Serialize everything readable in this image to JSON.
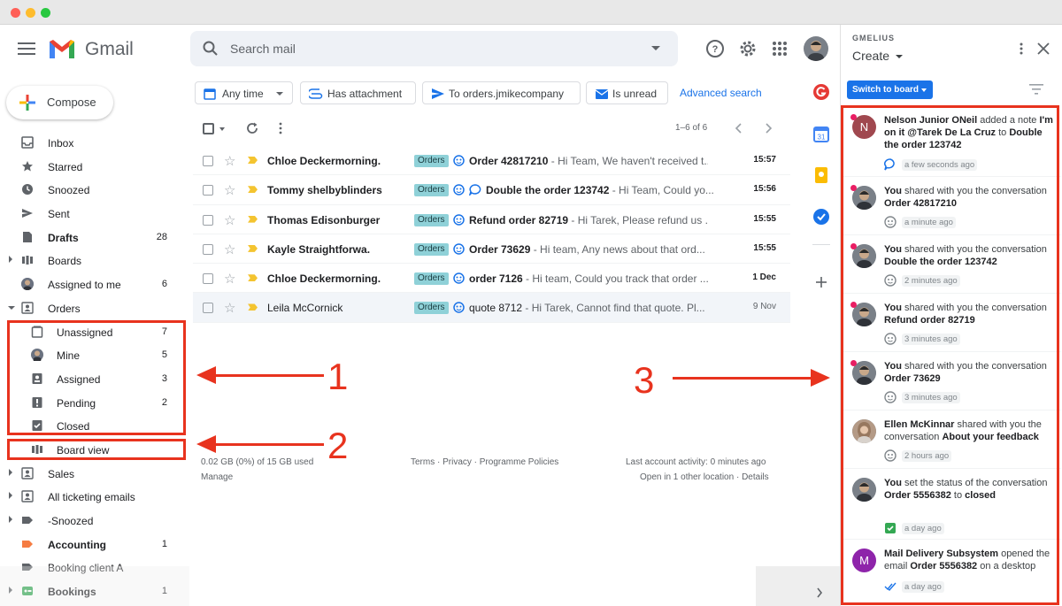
{
  "app": {
    "name": "Gmail"
  },
  "search": {
    "placeholder": "Search mail"
  },
  "compose": {
    "label": "Compose"
  },
  "sidebar": {
    "items": [
      {
        "label": "Inbox",
        "count": "",
        "bold": false
      },
      {
        "label": "Starred",
        "count": "",
        "bold": false
      },
      {
        "label": "Snoozed",
        "count": "",
        "bold": false
      },
      {
        "label": "Sent",
        "count": "",
        "bold": false
      },
      {
        "label": "Drafts",
        "count": "28",
        "bold": true
      },
      {
        "label": "Boards",
        "count": "",
        "bold": false
      },
      {
        "label": "Assigned to me",
        "count": "6",
        "bold": false
      },
      {
        "label": "Orders",
        "count": "",
        "bold": false
      },
      {
        "label": "Unassigned",
        "count": "7",
        "bold": false
      },
      {
        "label": "Mine",
        "count": "5",
        "bold": false
      },
      {
        "label": "Assigned",
        "count": "3",
        "bold": false
      },
      {
        "label": "Pending",
        "count": "2",
        "bold": false
      },
      {
        "label": "Closed",
        "count": "",
        "bold": false
      },
      {
        "label": "Board view",
        "count": "",
        "bold": false
      },
      {
        "label": "Sales",
        "count": "",
        "bold": false
      },
      {
        "label": "All ticketing emails",
        "count": "",
        "bold": false
      },
      {
        "label": "-Snoozed",
        "count": "",
        "bold": false
      },
      {
        "label": "Accounting",
        "count": "1",
        "bold": true
      },
      {
        "label": "Booking client A",
        "count": "",
        "bold": false
      },
      {
        "label": "Bookings",
        "count": "1",
        "bold": true
      }
    ]
  },
  "filters": {
    "any_time": "Any time",
    "has_attachment": "Has attachment",
    "to": "To orders.jmikecompany",
    "is_unread": "Is unread",
    "advanced": "Advanced search"
  },
  "pager": {
    "range": "1–6 of 6"
  },
  "emails": [
    {
      "sender": "Chloe Deckermorning.",
      "label": "Orders",
      "subject": "Order 42817210",
      "snippet": " - Hi Team, We haven't received t...",
      "time": "15:57"
    },
    {
      "sender": "Tommy shelbyblinders",
      "label": "Orders",
      "subject": "Double the order 123742",
      "snippet": " - Hi Team, Could yo...",
      "time": "15:56"
    },
    {
      "sender": "Thomas Edisonburger",
      "label": "Orders",
      "subject": "Refund order 82719",
      "snippet": " - Hi Tarek, Please refund us ...",
      "time": "15:55"
    },
    {
      "sender": "Kayle Straightforwa.",
      "label": "Orders",
      "subject": "Order 73629",
      "snippet": " - Hi team, Any news about that ord...",
      "time": "15:55"
    },
    {
      "sender": "Chloe Deckermorning.",
      "label": "Orders",
      "subject": "order 7126",
      "snippet": " - Hi team, Could you track that order ...",
      "time": "1 Dec"
    },
    {
      "sender": "Leila McCornick",
      "label": "Orders",
      "subject": "quote 8712",
      "snippet": " - Hi Tarek, Cannot find that quote. Pl...",
      "time": "9 Nov"
    }
  ],
  "footer": {
    "storage": "0.02 GB (0%) of 15 GB used",
    "manage": "Manage",
    "links": "Terms · Privacy · Programme Policies",
    "activity": "Last account activity: 0 minutes ago",
    "location": "Open in 1 other location · Details"
  },
  "gmelius": {
    "brand": "GMELIUS",
    "create": "Create",
    "switch": "Switch to board",
    "feed": [
      {
        "avatar": "N",
        "pre": "Nelson Junior ONeil",
        "mid": " added a note ",
        "bold2": "I'm on it @Tarek De La Cruz",
        "mid2": "  to ",
        "bold3": "Double the order 123742",
        "meta": "a few seconds ago"
      },
      {
        "pre": "You",
        "mid": " shared with you the conversation ",
        "bold2": "Order 42817210",
        "meta": "a minute ago"
      },
      {
        "pre": "You",
        "mid": " shared with you the conversation ",
        "bold2": "Double the order 123742",
        "meta": "2 minutes ago"
      },
      {
        "pre": "You",
        "mid": " shared with you the conversation ",
        "bold2": "Refund order 82719",
        "meta": "3 minutes ago"
      },
      {
        "pre": "You",
        "mid": " shared with you the conversation ",
        "bold2": "Order 73629",
        "meta": "3 minutes ago"
      },
      {
        "pre": "Ellen McKinnar",
        "mid": " shared with you the conversation ",
        "bold2": "About your feedback",
        "meta": "2 hours ago"
      },
      {
        "pre": "You",
        "mid": " set the status of the conversation ",
        "bold2": "Order 5556382",
        "mid2": " to ",
        "bold3": "closed",
        "meta": "a day ago"
      },
      {
        "avatar": "M",
        "pre": "Mail Delivery Subsystem",
        "mid": " opened the email ",
        "bold2": "Order 5556382",
        "mid2": " on a desktop",
        "meta": "a day ago"
      }
    ]
  },
  "annotations": {
    "n1": "1",
    "n2": "2",
    "n3": "3"
  },
  "colors": {
    "annotation": "#e8331e",
    "accent": "#1a73e8",
    "label_bg": "#8fd1d8"
  }
}
